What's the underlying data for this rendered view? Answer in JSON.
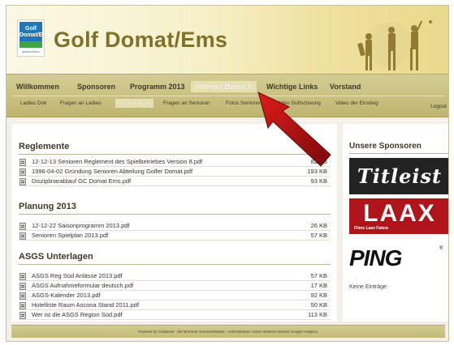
{
  "site": {
    "title": "Golf Domat/Ems",
    "logo_text": "Golf Domat/Ems",
    "logo_sub": "graubünden"
  },
  "nav": {
    "main": [
      {
        "label": "Willkommen",
        "active": false
      },
      {
        "label": "Sponsoren",
        "active": false
      },
      {
        "label": "Programm 2013",
        "active": false
      },
      {
        "label": "Interner Bereich",
        "active": true
      },
      {
        "label": "Wichtige Links",
        "active": false
      },
      {
        "label": "Vorstand",
        "active": false
      }
    ],
    "sub": [
      {
        "label": "Ladies Dok",
        "active": false
      },
      {
        "label": "Fragen an Ladies",
        "active": false
      },
      {
        "label": "Senioren Dok",
        "active": true
      },
      {
        "label": "Fragen an Senioren",
        "active": false
      },
      {
        "label": "Fotos Senioren",
        "active": false
      },
      {
        "label": "Video Golfscheung",
        "active": false
      },
      {
        "label": "Video der Einstieg",
        "active": false
      }
    ],
    "logout": "Logout"
  },
  "sections": [
    {
      "title": "Reglemente",
      "files": [
        {
          "name": "12-12-13 Senioren Reglement des Spielbetriebes Version 8.pdf",
          "size": "82 KB"
        },
        {
          "name": "1996-04-02 Gründung Senioren Abteilung Golfer Domat.pdf",
          "size": "193 KB"
        },
        {
          "name": "Disziplinarablauf GC Domat Ems.pdf",
          "size": "93 KB"
        }
      ]
    },
    {
      "title": "Planung 2013",
      "files": [
        {
          "name": "12-12-22 Saisonprogramm 2013.pdf",
          "size": "26 KB"
        },
        {
          "name": "Senioren Spielplan 2013.pdf",
          "size": "57 KB"
        }
      ]
    },
    {
      "title": "ASGS Unterlagen",
      "files": [
        {
          "name": "ASGS Reg Süd Anlässe 2013.pdf",
          "size": "57 KB"
        },
        {
          "name": "ASGS Aufnahmeformular deutsch.pdf",
          "size": "17 KB"
        },
        {
          "name": "ASGS-Kalender 2013.pdf",
          "size": "92 KB"
        },
        {
          "name": "Hotelliste Raum Ascona Stand 2011.pdf",
          "size": "50 KB"
        },
        {
          "name": "Wer ist die ASGS Region Süd.pdf",
          "size": "113 KB"
        }
      ]
    }
  ],
  "sidebar": {
    "title": "Unsere Sponsoren",
    "sponsors": [
      {
        "name": "Titleist",
        "color": "#222222"
      },
      {
        "name": "LAAX",
        "sub": "Flims Laax Falera",
        "color": "#b0141b"
      },
      {
        "name": "PING",
        "reg": "®"
      }
    ],
    "no_entries": "Keine Einträge"
  },
  "footer": {
    "text": "Powered by ClubDesk - die führende Vereinssoftware - Administration. Diese Website benutzt Google Analytics."
  },
  "icons": {
    "file": "pdf-file-icon",
    "arrow": "red-pointer-arrow-icon",
    "golfers": "golfer-silhouettes-icon"
  }
}
